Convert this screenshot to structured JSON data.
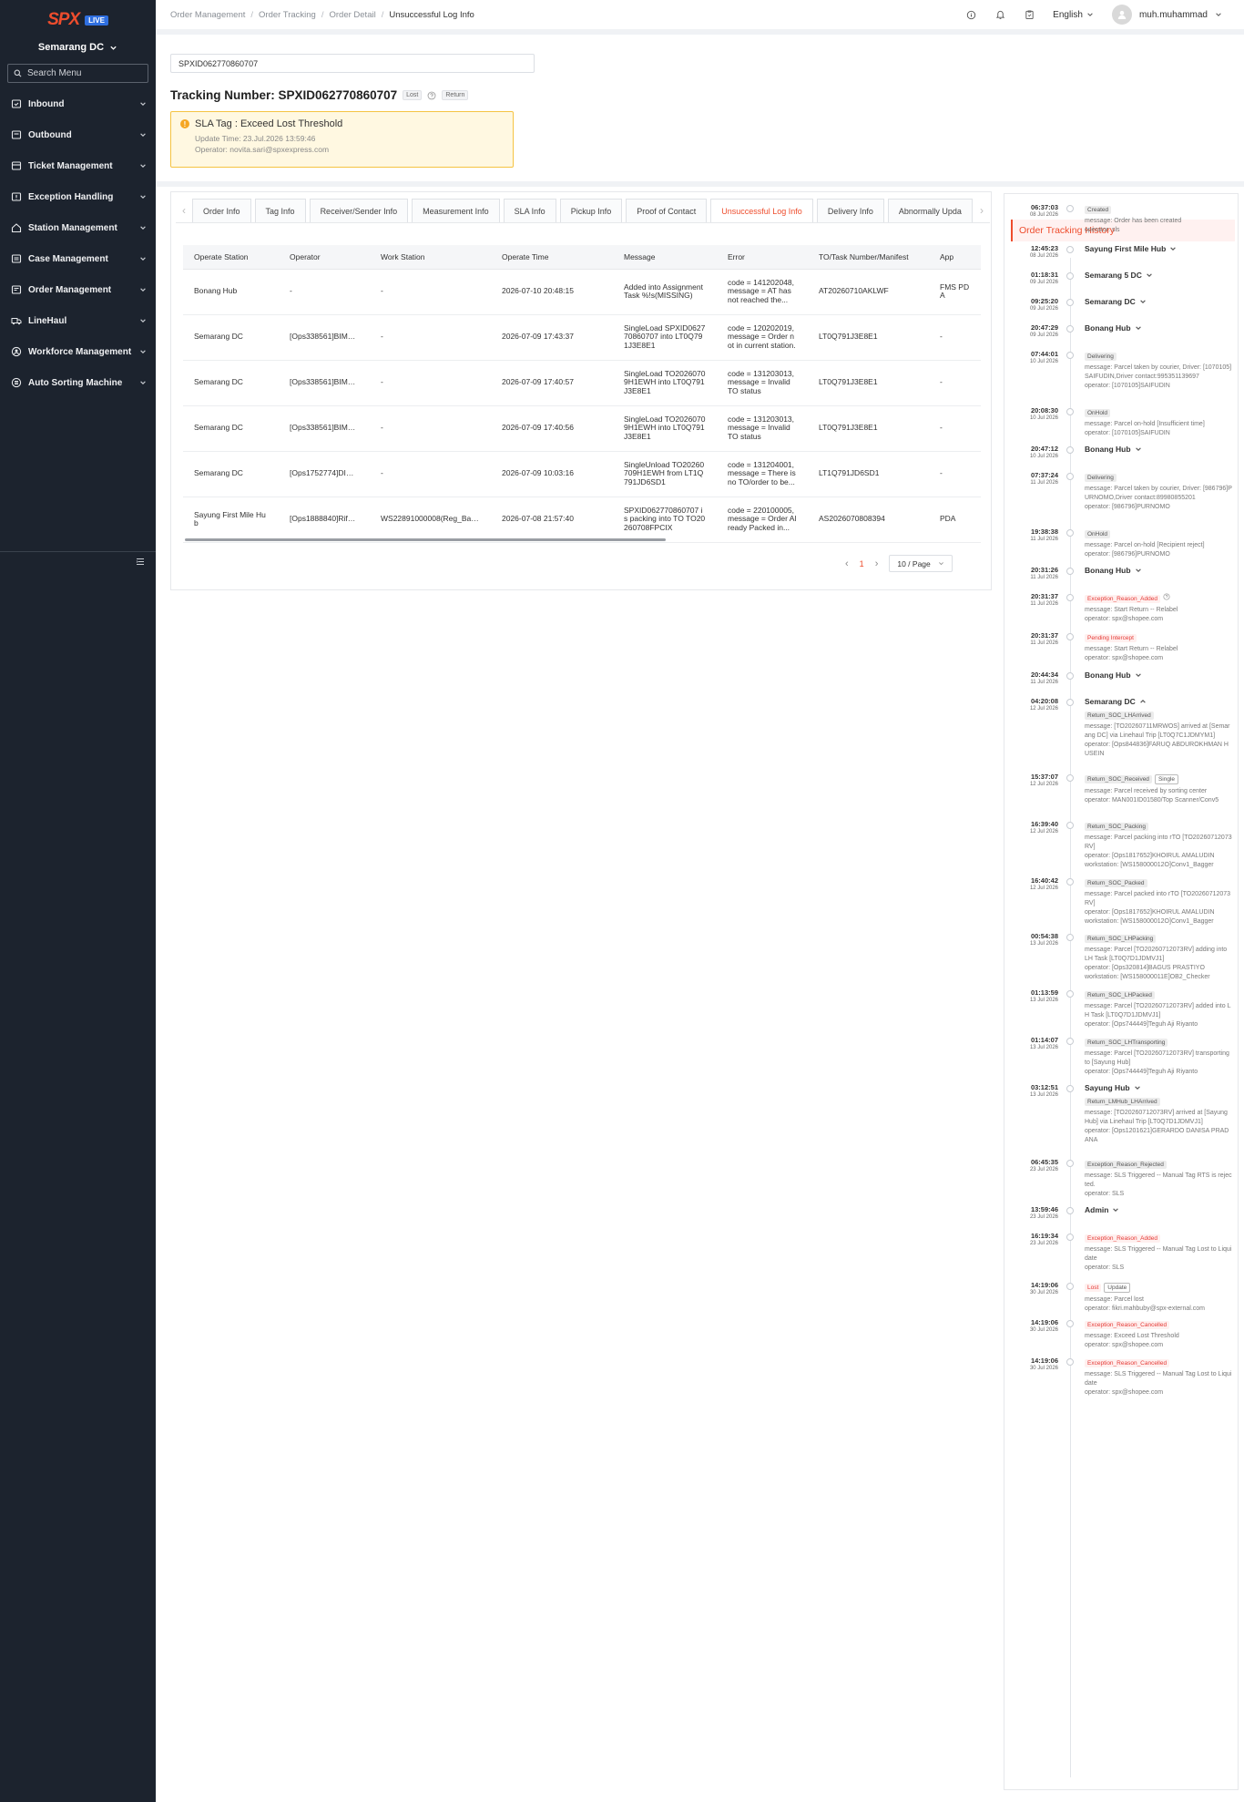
{
  "brand": {
    "logo": "SPX",
    "badge": "LIVE"
  },
  "sidebar": {
    "station": "Semarang DC",
    "search_placeholder": "Search Menu",
    "items": [
      {
        "label": "Inbound",
        "icon": "inbound-icon"
      },
      {
        "label": "Outbound",
        "icon": "outbound-icon"
      },
      {
        "label": "Ticket Management",
        "icon": "ticket-icon"
      },
      {
        "label": "Exception Handling",
        "icon": "exception-icon"
      },
      {
        "label": "Station Management",
        "icon": "station-icon"
      },
      {
        "label": "Case Management",
        "icon": "case-icon"
      },
      {
        "label": "Order Management",
        "icon": "order-icon"
      },
      {
        "label": "LineHaul",
        "icon": "truck-icon"
      },
      {
        "label": "Workforce Management",
        "icon": "workforce-icon"
      },
      {
        "label": "Auto Sorting Machine",
        "icon": "sorting-icon"
      }
    ]
  },
  "topbar": {
    "breadcrumb": [
      "Order Management",
      "Order Tracking",
      "Order Detail",
      "Unsuccessful Log Info"
    ],
    "language": "English",
    "user": "muh.muhammad"
  },
  "search": {
    "value": "SPXID062770860707"
  },
  "tracking": {
    "label": "Tracking Number: SPXID062770860707",
    "tag1": "Lost",
    "tag2": "Return"
  },
  "sla": {
    "title": "SLA Tag : Exceed Lost Threshold",
    "update": "Update Time: 23.Jul.2026 13:59:46",
    "operator": "Operator: novita.sari@spxexpress.com"
  },
  "tabs": [
    {
      "label": "Order Info",
      "active": false
    },
    {
      "label": "Tag Info",
      "active": false
    },
    {
      "label": "Receiver/Sender Info",
      "active": false
    },
    {
      "label": "Measurement Info",
      "active": false
    },
    {
      "label": "SLA Info",
      "active": false
    },
    {
      "label": "Pickup Info",
      "active": false
    },
    {
      "label": "Proof of Contact",
      "active": false
    },
    {
      "label": "Unsuccessful Log Info",
      "active": true
    },
    {
      "label": "Delivery Info",
      "active": false
    },
    {
      "label": "Abnormally Upda",
      "active": false
    }
  ],
  "table": {
    "columns": [
      "Operate Station",
      "Operator",
      "Work Station",
      "Operate Time",
      "Message",
      "Error",
      "TO/Task Number/Manifest",
      "App"
    ],
    "rows": [
      [
        "Bonang Hub",
        "-",
        "-",
        "2026-07-10 20:48:15",
        "Added into Assignment Task %!s(MISSING)",
        "code = 141202048, message = AT has not reached the...",
        "AT20260710AKLWF",
        "FMS PDA"
      ],
      [
        "Semarang DC",
        "[Ops338561]BIMA ...",
        "-",
        "2026-07-09 17:43:37",
        "SingleLoad SPXID062770860707 into LT0Q791J3E8E1",
        "code = 120202019, message = Order not in current station.",
        "LT0Q791J3E8E1",
        "-"
      ],
      [
        "Semarang DC",
        "[Ops338561]BIMA ...",
        "-",
        "2026-07-09 17:40:57",
        "SingleLoad TO20260709H1EWH into LT0Q791J3E8E1",
        "code = 131203013, message = Invalid TO status",
        "LT0Q791J3E8E1",
        "-"
      ],
      [
        "Semarang DC",
        "[Ops338561]BIMA ...",
        "-",
        "2026-07-09 17:40:56",
        "SingleLoad TO20260709H1EWH into LT0Q791J3E8E1",
        "code = 131203013, message = Invalid TO status",
        "LT0Q791J3E8E1",
        "-"
      ],
      [
        "Semarang DC",
        "[Ops1752774]DIST...",
        "-",
        "2026-07-09 10:03:16",
        "SingleUnload TO20260709H1EWH from LT1Q791JD6SD1",
        "code = 131204001, message = There is no TO/order to be...",
        "LT1Q791JD6SD1",
        "-"
      ],
      [
        "Sayung First Mile Hub",
        "[Ops1888840]Rifky ...",
        "WS22891000008(Reg_Bagg...",
        "2026-07-08 21:57:40",
        "SPXID062770860707 is packing into TO TO20260708FPCIX",
        "code = 220100005, message = Order Already Packed in...",
        "AS2026070808394",
        "PDA"
      ]
    ]
  },
  "pagination": {
    "page": "1",
    "size": "10 / Page"
  },
  "history": {
    "title": "Order Tracking History",
    "events": [
      {
        "time": "06:37:03",
        "date": "08 Jul 2026",
        "status": "Created",
        "status_type": "gray",
        "text": "message: Order has been created\noperator: sls"
      },
      {
        "time": "12:45:23",
        "date": "08 Jul 2026",
        "location": "Sayung First Mile Hub"
      },
      {
        "time": "01:18:31",
        "date": "09 Jul 2026",
        "location": "Semarang 5 DC"
      },
      {
        "time": "09:25:20",
        "date": "09 Jul 2026",
        "location": "Semarang DC"
      },
      {
        "time": "20:47:29",
        "date": "09 Jul 2026",
        "location": "Bonang Hub"
      },
      {
        "time": "07:44:01",
        "date": "10 Jul 2026",
        "status": "Delivering",
        "status_type": "gray",
        "text": "message: Parcel taken by courier, Driver: [1070105]SAIFUDIN,Driver contact:995351139697\noperator: [1070105]SAIFUDIN"
      },
      {
        "time": "20:08:30",
        "date": "10 Jul 2026",
        "status": "OnHold",
        "status_type": "gray",
        "text": "message: Parcel on-hold [Insufficient time]\noperator: [1070105]SAIFUDIN"
      },
      {
        "time": "20:47:12",
        "date": "10 Jul 2026",
        "location": "Bonang Hub"
      },
      {
        "time": "07:37:24",
        "date": "11 Jul 2026",
        "status": "Delivering",
        "status_type": "gray",
        "text": "message: Parcel taken by courier, Driver: [986796]PURNOMO,Driver contact:89980855201\noperator: [986796]PURNOMO"
      },
      {
        "time": "19:38:38",
        "date": "11 Jul 2026",
        "status": "OnHold",
        "status_type": "gray",
        "text": "message: Parcel on-hold [Recipient reject]\noperator: [986796]PURNOMO"
      },
      {
        "time": "20:31:26",
        "date": "11 Jul 2026",
        "location": "Bonang Hub"
      },
      {
        "time": "20:31:37",
        "date": "11 Jul 2026",
        "status": "Exception_Reason_Added",
        "status_type": "red",
        "text": "message: Start Return -- Relabel\noperator: spx@shopee.com"
      },
      {
        "time": "20:31:37",
        "date": "11 Jul 2026",
        "status": "Pending Intercept",
        "status_type": "red",
        "text": "message: Start Return -- Relabel\noperator: spx@shopee.com"
      },
      {
        "time": "20:44:34",
        "date": "11 Jul 2026",
        "location": "Bonang Hub"
      },
      {
        "time": "04:20:08",
        "date": "12 Jul 2026",
        "location": "Semarang DC",
        "status": "Return_SOC_LHArrived",
        "status_type": "gray",
        "text": "message: [TO20260711MRWOS] arrived at [Semarang DC] via Linehaul Trip [LT0Q7C1JDMYM1]\noperator: [Ops844836]FARUQ ABDUROKHMAN HUSEIN"
      },
      {
        "time": "15:37:07",
        "date": "12 Jul 2026",
        "status": "Return_SOC_Received",
        "status_type": "gray",
        "badge": "Single",
        "text": "message: Parcel received by sorting center\noperator: MAN001ID01580/Top Scanner/Conv5"
      },
      {
        "time": "16:39:40",
        "date": "12 Jul 2026",
        "status": "Return_SOC_Packing",
        "status_type": "gray",
        "text": "message: Parcel packing into rTO [TO20260712073RV]\noperator: [Ops1817652]KHOIRUL AMALUDIN\nworkstation: [WS158000012O]Conv1_Bagger"
      },
      {
        "time": "16:40:42",
        "date": "12 Jul 2026",
        "status": "Return_SOC_Packed",
        "status_type": "gray",
        "text": "message: Parcel packed into rTO [TO20260712073RV]\noperator: [Ops1817652]KHOIRUL AMALUDIN\nworkstation: [WS158000012O]Conv1_Bagger"
      },
      {
        "time": "00:54:38",
        "date": "13 Jul 2026",
        "status": "Return_SOC_LHPacking",
        "status_type": "gray",
        "text": "message: Parcel [TO20260712073RV] adding into LH Task [LT0Q7D1JDMVJ1]\noperator: [Ops320814]BAGUS PRASTIYO\nworkstation: [WS158000011E]OB2_Checker"
      },
      {
        "time": "01:13:59",
        "date": "13 Jul 2026",
        "status": "Return_SOC_LHPacked",
        "status_type": "gray",
        "text": "message: Parcel [TO20260712073RV] added into LH Task [LT0Q7D1JDMVJ1]\noperator: [Ops744449]Teguh Aji Riyanto"
      },
      {
        "time": "01:14:07",
        "date": "13 Jul 2026",
        "status": "Return_SOC_LHTransporting",
        "status_type": "gray",
        "text": "message: Parcel [TO20260712073RV] transporting to [Sayung Hub]\noperator: [Ops744449]Teguh Aji Riyanto"
      },
      {
        "time": "03:12:51",
        "date": "13 Jul 2026",
        "location": "Sayung Hub",
        "status": "Return_LMHub_LHArrived",
        "status_type": "gray",
        "text": "message: [TO20260712073RV] arrived at [Sayung Hub] via Linehaul Trip [LT0Q7D1JDMVJ1]\noperator: [Ops1201621]GERARDO DANISA PRADANA"
      },
      {
        "time": "06:45:35",
        "date": "23 Jul 2026",
        "status": "Exception_Reason_Rejected",
        "status_type": "gray",
        "text": "message: SLS Triggered -- Manual Tag RTS is rejected.\noperator: SLS"
      },
      {
        "time": "13:59:46",
        "date": "23 Jul 2026",
        "location": "Admin"
      },
      {
        "time": "16:19:34",
        "date": "23 Jul 2026",
        "status": "Exception_Reason_Added",
        "status_type": "red",
        "text": "message: SLS Triggered -- Manual Tag Lost to Liquidate\noperator: SLS"
      },
      {
        "time": "14:19:06",
        "date": "30 Jul 2026",
        "status": "Lost",
        "status_type": "red",
        "badge": "Update",
        "text": "message: Parcel lost\noperator: fikri.mahbuby@spx-external.com"
      },
      {
        "time": "14:19:06",
        "date": "30 Jul 2026",
        "status": "Exception_Reason_Cancelled",
        "status_type": "red",
        "text": "message: Exceed Lost Threshold\noperator: spx@shopee.com"
      },
      {
        "time": "14:19:06",
        "date": "30 Jul 2026",
        "status": "Exception_Reason_Cancelled",
        "status_type": "red",
        "text": "message: SLS Triggered -- Manual Tag Lost to Liquidate\noperator: spx@shopee.com"
      }
    ]
  },
  "colors": {
    "accent": "#ee4d2d",
    "sidebar": "#1c232e",
    "warning_bg": "#fff8e1",
    "warning_border": "#f5c342"
  }
}
